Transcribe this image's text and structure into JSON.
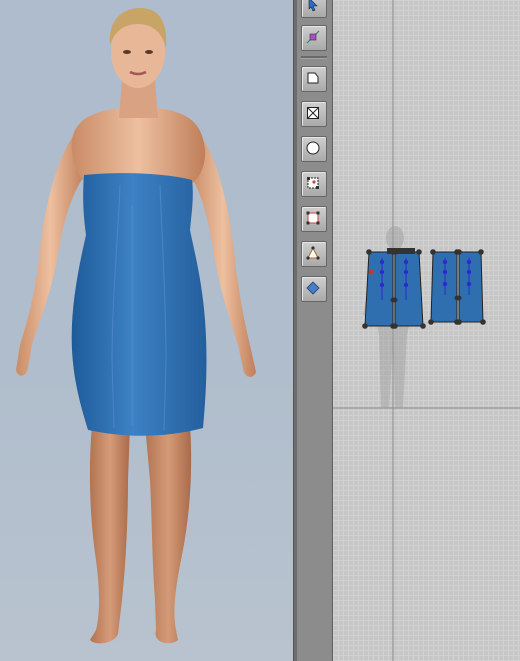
{
  "viewport3d": {
    "background_top": "#aebccd",
    "background_bottom": "#b8c3cf",
    "garment_color": "#2f6fb0",
    "skin_color": "#e3b08d",
    "hair_color": "#c9a467"
  },
  "toolbar": {
    "tools": [
      {
        "name": "select-move-tool",
        "icon": "pointer-arrow-icon"
      },
      {
        "name": "edit-point-tool",
        "icon": "point-edit-icon"
      },
      {
        "name": "polygon-tool",
        "icon": "polygon-icon"
      },
      {
        "name": "rectangle-tool",
        "icon": "rectangle-icon"
      },
      {
        "name": "circle-tool",
        "icon": "circle-icon"
      },
      {
        "name": "add-point-tool",
        "icon": "add-point-icon"
      },
      {
        "name": "transform-pattern-tool",
        "icon": "transform-box-icon"
      },
      {
        "name": "sewing-tool",
        "icon": "sewing-icon"
      },
      {
        "name": "fold-tool",
        "icon": "fold-diamond-icon"
      }
    ]
  },
  "pattern_view": {
    "grid_color": "#c6c6c6",
    "panel_color": "#2f6fb0",
    "point_color": "#333333",
    "dart_point_color": "#2b2ad0"
  }
}
